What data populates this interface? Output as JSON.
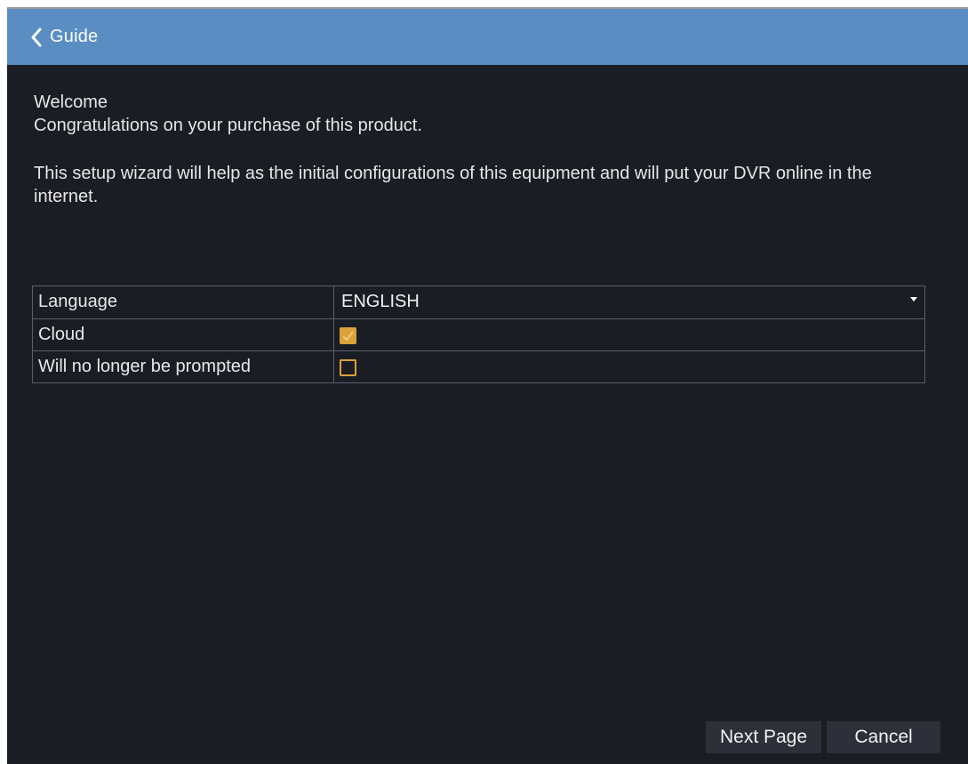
{
  "header": {
    "title": "Guide",
    "back_icon": "chevron-left-icon"
  },
  "intro": {
    "welcome": "Welcome",
    "congrats": "Congratulations on your purchase of this product.",
    "wizard_text": "This setup wizard will help as the initial configurations of this equipment and will put your DVR online in the internet."
  },
  "settings": {
    "language": {
      "label": "Language",
      "value": "ENGLISH"
    },
    "cloud": {
      "label": "Cloud",
      "checked": true
    },
    "no_prompt": {
      "label": "Will no longer be prompted",
      "checked": false
    }
  },
  "footer": {
    "next_label": "Next Page",
    "cancel_label": "Cancel"
  },
  "colors": {
    "header_bg": "#5a8dc2",
    "window_bg": "#1b1d25",
    "accent": "#d9a23a",
    "button_bg": "#2d3038"
  }
}
